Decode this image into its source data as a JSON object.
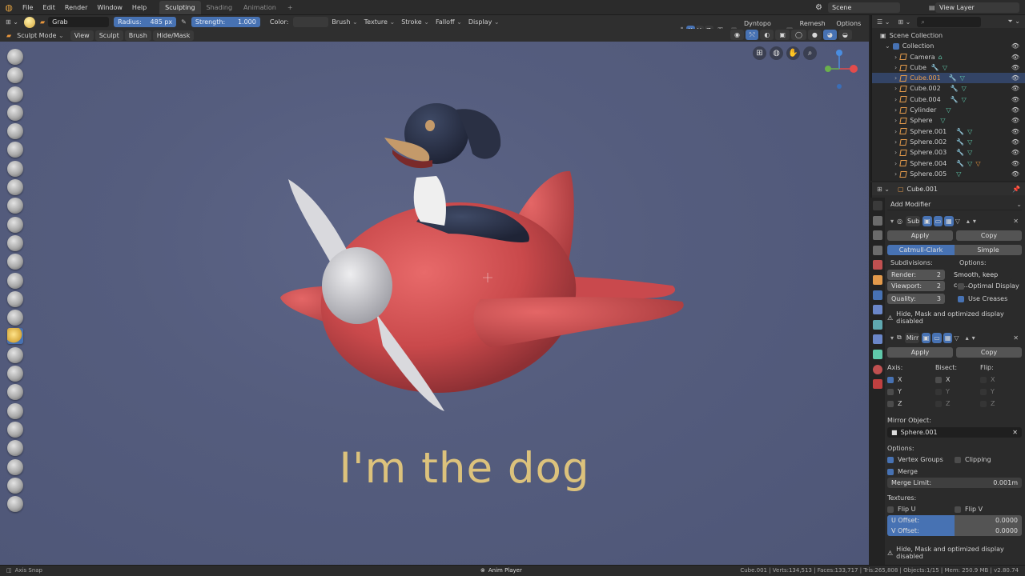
{
  "topbar": {
    "menus": [
      "File",
      "Edit",
      "Render",
      "Window",
      "Help"
    ],
    "tabs": [
      "Sculpting",
      "Shading",
      "Animation"
    ],
    "active_tab": "Sculpting",
    "add_tab": "+",
    "scene": "Scene",
    "view_layer": "View Layer"
  },
  "tool_header": {
    "brush_name": "Grab",
    "radius_label": "Radius:",
    "radius_value": "485 px",
    "strength_label": "Strength:",
    "strength_value": "1.000",
    "color_label": "Color:",
    "menus": [
      "Brush",
      "Texture",
      "Stroke",
      "Falloff",
      "Display"
    ],
    "axes": [
      "X",
      "Y",
      "Z"
    ],
    "dyntopo": "Dyntopo",
    "remesh": "Remesh",
    "options": "Options"
  },
  "mode_header": {
    "mode": "Sculpt Mode",
    "menus": [
      "View",
      "Sculpt",
      "Brush",
      "Hide/Mask"
    ]
  },
  "viewport": {
    "caption": "I'm the dog",
    "gizmo_axes": {
      "x": "X",
      "y": "Y",
      "z": "Z"
    }
  },
  "colors": {
    "accent": "#4772b3",
    "caption": "#dcc27c",
    "object_orange": "#e39a4b",
    "mesh_green": "#5fc8aa",
    "viewport_bg": "#555d7e"
  },
  "outliner": {
    "root": "Scene Collection",
    "items": [
      {
        "name": "Collection"
      },
      {
        "name": "Camera"
      },
      {
        "name": "Cube"
      },
      {
        "name": "Cube.001",
        "active": true
      },
      {
        "name": "Cube.002"
      },
      {
        "name": "Cube.004"
      },
      {
        "name": "Cylinder"
      },
      {
        "name": "Sphere"
      },
      {
        "name": "Sphere.001"
      },
      {
        "name": "Sphere.002"
      },
      {
        "name": "Sphere.003"
      },
      {
        "name": "Sphere.004"
      },
      {
        "name": "Sphere.005"
      }
    ]
  },
  "properties": {
    "object_name": "Cube.001",
    "add_modifier": "Add Modifier",
    "subsurf": {
      "name": "Sub",
      "apply": "Apply",
      "copy": "Copy",
      "catmull": "Catmull-Clark",
      "simple": "Simple",
      "subdivisions_label": "Subdivisions:",
      "options_label": "Options:",
      "render_label": "Render:",
      "render_value": "2",
      "viewport_label": "Viewport:",
      "viewport_value": "2",
      "quality_label": "Quality:",
      "quality_value": "3",
      "uv_smooth": "Smooth, keep cor...",
      "optimal_display": "Optimal Display",
      "use_creases": "Use Creases",
      "warning": "Hide, Mask and optimized display disabled"
    },
    "mirror": {
      "name": "Mirr",
      "apply": "Apply",
      "copy": "Copy",
      "axis_label": "Axis:",
      "bisect_label": "Bisect:",
      "flip_label": "Flip:",
      "x": "X",
      "y": "Y",
      "z": "Z",
      "mirror_object_label": "Mirror Object:",
      "mirror_object": "Sphere.001",
      "options_label": "Options:",
      "vertex_groups": "Vertex Groups",
      "clipping": "Clipping",
      "merge": "Merge",
      "merge_limit_label": "Merge Limit:",
      "merge_limit_value": "0.001m",
      "textures_label": "Textures:",
      "flip_u": "Flip U",
      "flip_v": "Flip V",
      "u_offset_label": "U Offset:",
      "u_offset_value": "0.0000",
      "v_offset_label": "V Offset:",
      "v_offset_value": "0.0000",
      "warning": "Hide, Mask and optimized display disabled"
    }
  },
  "statusbar": {
    "left": "Axis Snap",
    "center": "Anim Player",
    "right": "Cube.001 | Verts:134,513 | Faces:133,717 | Tris:265,808 | Objects:1/15 | Mem: 250.9 MB | v2.80.74"
  }
}
